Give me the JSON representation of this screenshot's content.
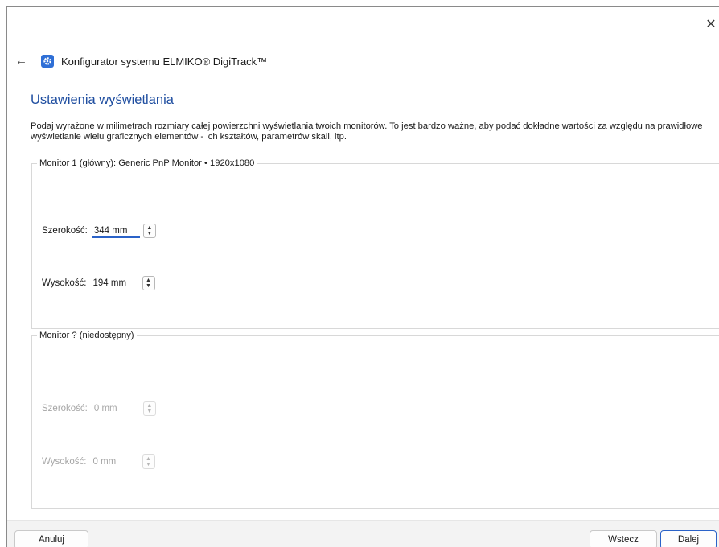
{
  "window": {
    "close_glyph": "✕"
  },
  "header": {
    "back_glyph": "←",
    "icon": "gear-icon",
    "accent_color": "#2f6fd6",
    "title": "Konfigurator systemu ELMIKO® DigiTrack™"
  },
  "page": {
    "title": "Ustawienia wyświetlania",
    "description": "Podaj wyrażone w milimetrach rozmiary całej powierzchni wyświetlania twoich monitorów. To jest bardzo ważne, aby podać dokładne wartości za względu na prawidłowe wyświetlanie wielu graficznych elementów - ich kształtów, parametrów skali, itp."
  },
  "monitor1": {
    "legend": "Monitor 1 (główny): Generic PnP Monitor  •  1920x1080",
    "width_label": "Szerokość:",
    "width_value": "344 mm",
    "height_label": "Wysokość:",
    "height_value": "194 mm"
  },
  "monitor2": {
    "legend": "Monitor ? (niedostępny)",
    "width_label": "Szerokość:",
    "width_value": "0 mm",
    "height_label": "Wysokość:",
    "height_value": "0 mm"
  },
  "footer": {
    "cancel_label": "Anuluj",
    "back_label": "Wstecz",
    "next_label": "Dalej"
  }
}
